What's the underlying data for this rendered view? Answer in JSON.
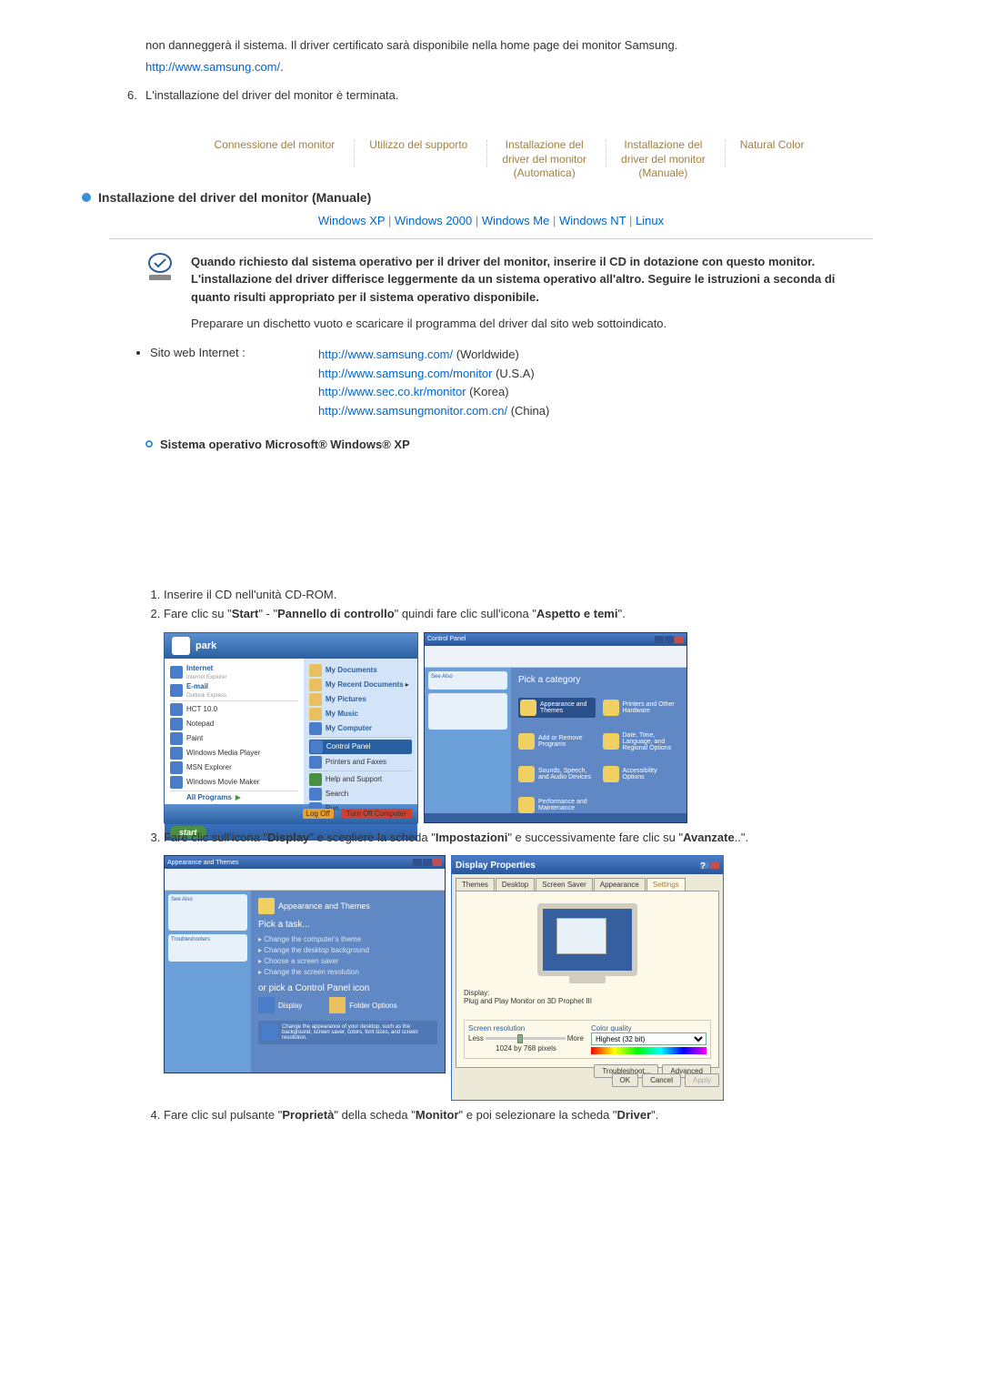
{
  "intro": {
    "para1": "non danneggerà il sistema. Il driver certificato sarà disponibile nella home page dei monitor Samsung.",
    "link1": "http://www.samsung.com/",
    "step6_num": "6.",
    "step6": "L'installazione del driver del monitor è terminata."
  },
  "tabs": {
    "t1": "Connessione del monitor",
    "t2": "Utilizzo del supporto",
    "t3_l1": "Installazione del",
    "t3_l2": "driver del monitor",
    "t3_l3": "(Automatica)",
    "t4_l1": "Installazione del",
    "t4_l2": "driver del monitor",
    "t4_l3": "(Manuale)",
    "t5": "Natural Color"
  },
  "heading": "Installazione del driver del monitor (Manuale)",
  "os": {
    "xp": "Windows XP",
    "w2000": "Windows 2000",
    "me": "Windows Me",
    "nt": "Windows NT",
    "linux": "Linux"
  },
  "box": {
    "bold": "Quando richiesto dal sistema operativo per il driver del monitor, inserire il CD in dotazione con questo monitor. L'installazione del driver differisce leggermente da un sistema operativo all'altro. Seguire le istruzioni a seconda di quanto risulti appropriato per il sistema operativo disponibile.",
    "prepare": "Preparare un dischetto vuoto e scaricare il programma del driver dal sito web sottoindicato."
  },
  "site": {
    "label": "Sito web Internet :",
    "url1": "http://www.samsung.com/",
    "suffix1": " (Worldwide)",
    "url2": "http://www.samsung.com/monitor",
    "suffix2": " (U.S.A)",
    "url3": "http://www.sec.co.kr/monitor",
    "suffix3": " (Korea)",
    "url4": "http://www.samsungmonitor.com.cn/",
    "suffix4": " (China)"
  },
  "sub_heading": "Sistema operativo Microsoft® Windows® XP",
  "steps": {
    "s1": "Inserire il CD nell'unità CD-ROM.",
    "s2a": "Fare clic su \"",
    "s2b": "Start",
    "s2c": "\" - \"",
    "s2d": "Pannello di controllo",
    "s2e": "\" quindi fare clic sull'icona \"",
    "s2f": "Aspetto e temi",
    "s2g": "\".",
    "s3a": "Fare clic sull'icona \"",
    "s3b": "Display",
    "s3c": "\" e scegliere la scheda \"",
    "s3d": "Impostazioni",
    "s3e": "\" e successivamente fare clic su \"",
    "s3f": "Avanzate",
    "s3g": "..\".",
    "s4a": "Fare clic sul pulsante \"",
    "s4b": "Proprietà",
    "s4c": "\" della scheda \"",
    "s4d": "Monitor",
    "s4e": "\" e poi selezionare la scheda \"",
    "s4f": "Driver",
    "s4g": "\"."
  },
  "startmenu": {
    "user": "park",
    "internet": "Internet",
    "internet_sub": "Internet Explorer",
    "email": "E-mail",
    "email_sub": "Outlook Express",
    "hct": "HCT 10.0",
    "notepad": "Notepad",
    "paint": "Paint",
    "wmp": "Windows Media Player",
    "msn": "MSN Explorer",
    "wmm": "Windows Movie Maker",
    "allprograms": "All Programs",
    "mydocs": "My Documents",
    "myrecent": "My Recent Documents",
    "mypics": "My Pictures",
    "mymusic": "My Music",
    "mycomp": "My Computer",
    "cp": "Control Panel",
    "printers": "Printers and Faxes",
    "help": "Help and Support",
    "search": "Search",
    "run": "Run...",
    "logoff": "Log Off",
    "turnoff": "Turn Off Computer",
    "start": "start"
  },
  "cp": {
    "title": "Control Panel",
    "pick": "Pick a category",
    "seealso": "See Also",
    "cat1": "Appearance and Themes",
    "cat2": "Printers and Other Hardware",
    "cat3": "Add or Remove Programs",
    "cat4": "Date, Time, Language, and Regional Options",
    "cat5": "Sounds, Speech, and Audio Devices",
    "cat6": "Accessibility Options",
    "cat7": "Performance and Maintenance"
  },
  "at": {
    "title": "Appearance and Themes",
    "seealso": "See Also",
    "trouble": "Troubleshooters",
    "cat": "Appearance and Themes",
    "picktask": "Pick a task...",
    "task1": "Change the computer's theme",
    "task2": "Change the desktop background",
    "task3": "Choose a screen saver",
    "task4": "Change the screen resolution",
    "orpick": "or pick a Control Panel icon",
    "icon1": "Display",
    "icon2": "Folder Options",
    "desc": "Change the appearance of your desktop, such as the background, screen saver, colors, font sizes, and screen resolution."
  },
  "dp": {
    "title": "Display Properties",
    "tab1": "Themes",
    "tab2": "Desktop",
    "tab3": "Screen Saver",
    "tab4": "Appearance",
    "tab5": "Settings",
    "display_label": "Display:",
    "display_val": "Plug and Play Monitor on 3D Prophet III",
    "resolution": "Screen resolution",
    "less": "Less",
    "more": "More",
    "resval": "1024 by 768 pixels",
    "quality": "Color quality",
    "quality_val": "Highest (32 bit)",
    "troubleshoot": "Troubleshoot...",
    "advanced": "Advanced",
    "ok": "OK",
    "cancel": "Cancel",
    "apply": "Apply"
  }
}
